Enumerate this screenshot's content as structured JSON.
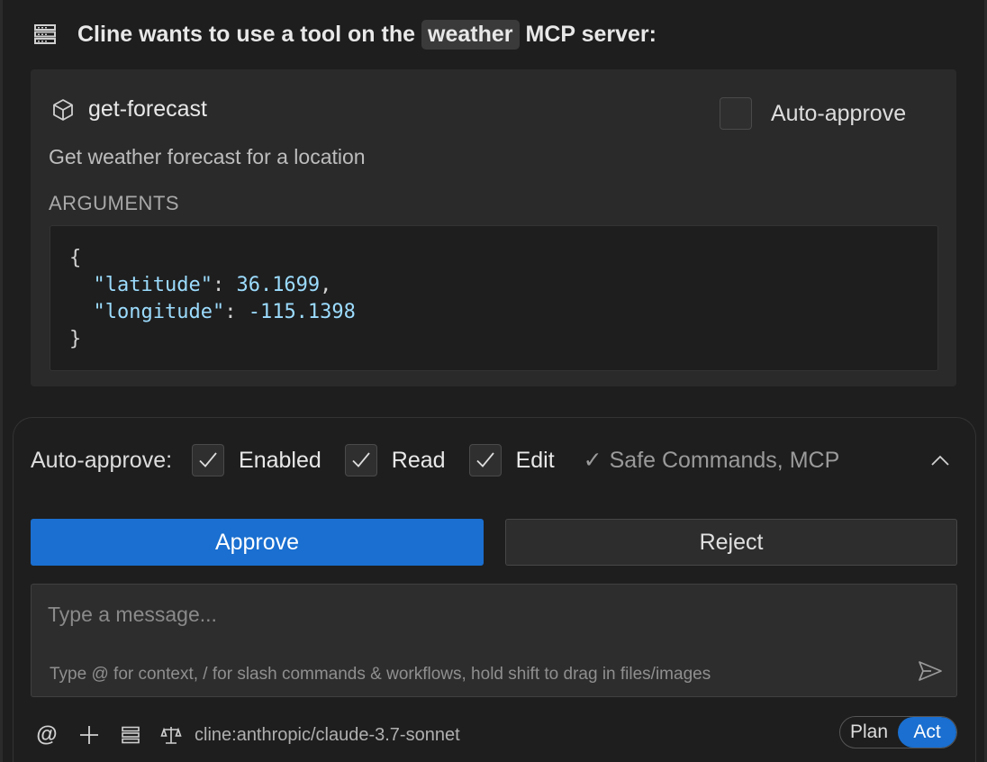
{
  "header": {
    "prefix": "Cline wants to use a tool on the",
    "server_name": "weather",
    "suffix": "MCP server:"
  },
  "tool": {
    "name": "get-forecast",
    "auto_approve_label": "Auto-approve",
    "auto_approve_checked": false,
    "description": "Get weather forecast for a location",
    "arguments_label": "ARGUMENTS",
    "arguments": {
      "open": "{",
      "close": "}",
      "lines": [
        {
          "key": "\"latitude\"",
          "value": "36.1699",
          "trailing": ","
        },
        {
          "key": "\"longitude\"",
          "value": "-115.1398",
          "trailing": ""
        }
      ]
    }
  },
  "auto_approve": {
    "label": "Auto-approve:",
    "items": [
      {
        "label": "Enabled",
        "checked": true
      },
      {
        "label": "Read",
        "checked": true
      },
      {
        "label": "Edit",
        "checked": true
      }
    ],
    "summary": "Safe Commands, MCP",
    "summary_tick": "✓"
  },
  "actions": {
    "approve_label": "Approve",
    "reject_label": "Reject"
  },
  "message": {
    "placeholder": "Type a message...",
    "hint": "Type @ for context, / for slash commands & workflows, hold shift to drag in files/images"
  },
  "footer": {
    "at_symbol": "@",
    "model": "cline:anthropic/claude-3.7-sonnet",
    "mode_plan": "Plan",
    "mode_act": "Act",
    "active_mode": "Act"
  },
  "colors": {
    "accent": "#1a6fd0",
    "background": "#1e1e1e",
    "card": "#2a2a2a",
    "json_key": "#9cdcfe"
  }
}
